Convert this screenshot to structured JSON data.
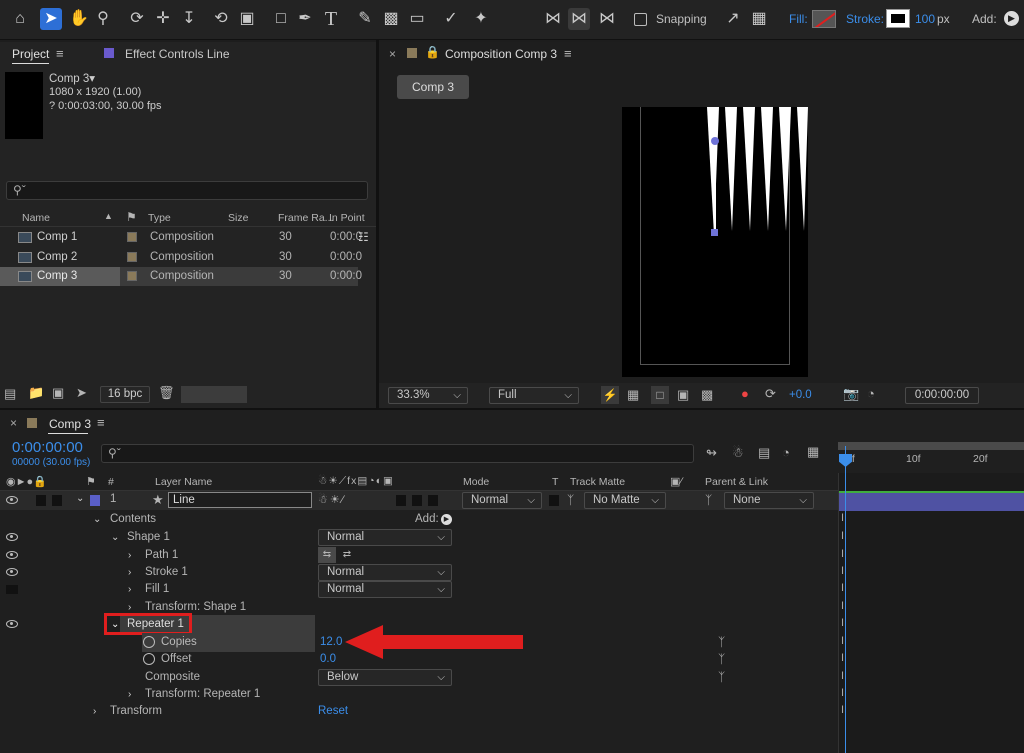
{
  "toolbar": {
    "snapping_label": "Snapping",
    "fill_label": "Fill:",
    "stroke_label": "Stroke:",
    "stroke_width": "100",
    "stroke_unit": "px",
    "add_label": "Add:"
  },
  "project_panel": {
    "tab_project": "Project",
    "tab_effect_controls": "Effect Controls Line",
    "comp_name": "Comp 3▾",
    "comp_size": "1080 x 1920 (1.00)",
    "comp_duration": "? 0:00:03:00, 30.00 fps",
    "columns": [
      "Name",
      "Type",
      "Size",
      "Frame Ra...",
      "In Point"
    ],
    "rows": [
      {
        "name": "Comp 1",
        "type": "Composition",
        "frame_rate": "30",
        "in_point": "0:00:0"
      },
      {
        "name": "Comp 2",
        "type": "Composition",
        "frame_rate": "30",
        "in_point": "0:00:0"
      },
      {
        "name": "Comp 3",
        "type": "Composition",
        "frame_rate": "30",
        "in_point": "0:00:0"
      }
    ],
    "bpc_label": "16 bpc"
  },
  "composition_panel": {
    "tab_title": "Composition Comp 3",
    "comp_tab": "Comp 3",
    "zoom": "33.3%",
    "resolution": "Full",
    "exposure": "+0.0",
    "timecode": "0:00:00:00"
  },
  "timeline": {
    "tab_title": "Comp 3",
    "current_time": "0:00:00:00",
    "frame_info": "00000 (30.00 fps)",
    "columns": {
      "layer_name": "Layer Name",
      "hash": "#",
      "mode": "Mode",
      "t": "T",
      "track_matte": "Track Matte",
      "parent_link": "Parent & Link"
    },
    "ruler": [
      "0f",
      "10f",
      "20f"
    ],
    "layer": {
      "number": "1",
      "name": "Line",
      "mode": "Normal",
      "matte": "No Matte",
      "parent": "None"
    },
    "properties": [
      {
        "label": "Contents",
        "indent": 0,
        "value": "Add:",
        "value_type": "add"
      },
      {
        "label": "Shape 1",
        "indent": 1,
        "value": "Normal",
        "value_type": "dropdown"
      },
      {
        "label": "Path 1",
        "indent": 2,
        "value": "",
        "value_type": "icons"
      },
      {
        "label": "Stroke 1",
        "indent": 2,
        "value": "Normal",
        "value_type": "dropdown"
      },
      {
        "label": "Fill 1",
        "indent": 2,
        "value": "Normal",
        "value_type": "dropdown"
      },
      {
        "label": "Transform: Shape 1",
        "indent": 2,
        "value": "",
        "value_type": "none"
      },
      {
        "label": "Repeater 1",
        "indent": 1,
        "value": "",
        "value_type": "none"
      },
      {
        "label": "Copies",
        "indent": 3,
        "value": "12.0",
        "value_type": "number"
      },
      {
        "label": "Offset",
        "indent": 3,
        "value": "0.0",
        "value_type": "number"
      },
      {
        "label": "Composite",
        "indent": 3,
        "value": "Below",
        "value_type": "dropdown"
      },
      {
        "label": "Transform: Repeater 1",
        "indent": 2,
        "value": "",
        "value_type": "none"
      },
      {
        "label": "Transform",
        "indent": 0,
        "value": "Reset",
        "value_type": "link"
      }
    ]
  },
  "colors": {
    "accent_blue": "#2d6fd6",
    "highlight_red": "#e01e1e",
    "timecode_blue": "#3b8eea"
  }
}
